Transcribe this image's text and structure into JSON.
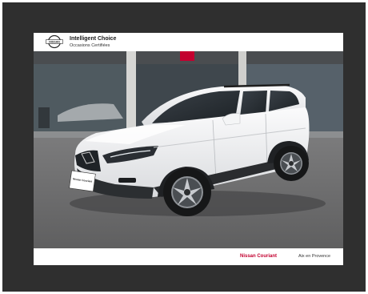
{
  "brand": {
    "logo_text": "NISSAN",
    "title": "Intelligent Choice",
    "subtitle": "Occasions Certifiées"
  },
  "footer": {
    "dealer": "Nissan Couriant",
    "city": "Aix en Provence"
  },
  "photo": {
    "subject": "white-nissan-qashqai-suv",
    "plate_text": "Nissan Couriant"
  },
  "colors": {
    "frame": "#2f2f2f",
    "card": "#ffffff",
    "accent_red": "#c3002f",
    "car_body": "#f2f3f4",
    "asphalt": "#6b6b6c"
  }
}
